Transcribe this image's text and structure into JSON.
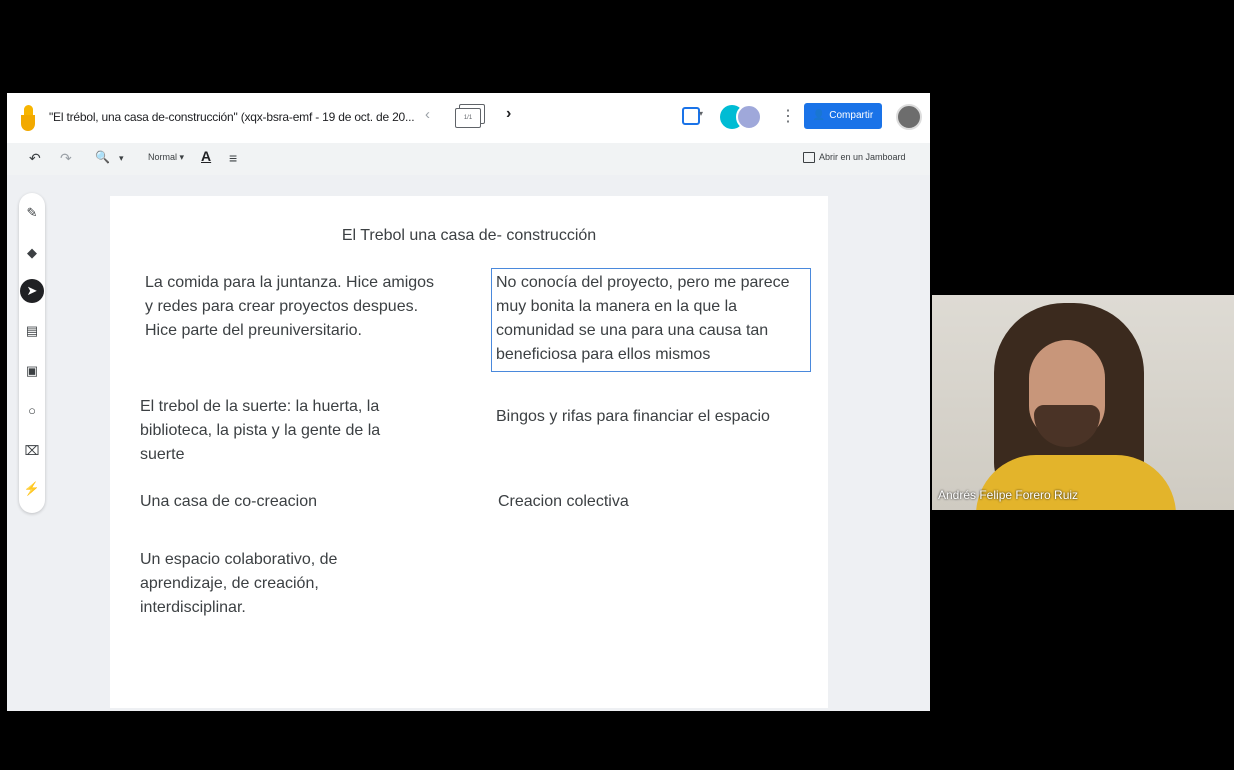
{
  "header": {
    "doc_title": "\"El trébol, una casa de-construcción\" (xqx-bsra-emf - 19 de oct. de 20...",
    "prev_icon": "chevron-left-icon",
    "frame_counter": "1/1",
    "next_icon": "chevron-right-icon",
    "share_label": "Compartir",
    "share_color": "#1a73e8"
  },
  "toolbar": {
    "undo_glyph": "↶",
    "redo_glyph": "↷",
    "zoom_glyph": "🔍",
    "zoom_arrow": "▾",
    "text_style": "Normal ▾",
    "text_color_glyph": "A",
    "align_glyph": "≡",
    "open_jamboard": "Abrir en un Jamboard"
  },
  "tools": [
    "pen-icon",
    "eraser-icon",
    "select-icon",
    "sticky-note-icon",
    "image-icon",
    "circle-icon",
    "text-box-icon",
    "laser-icon"
  ],
  "board": {
    "title": "El Trebol una casa de- construcción",
    "notes": [
      "La comida para la juntanza. Hice amigos y redes para crear proyectos despues. Hice parte del preuniversitario.",
      "No conocía del proyecto, pero me parece muy bonita la manera en la que la comunidad se una para una causa tan beneficiosa para ellos mismos",
      "El trebol de la suerte: la huerta, la biblioteca, la pista y la gente de la suerte",
      "Bingos y rifas para financiar el espacio",
      "Una casa de co-creacion",
      "Creacion colectiva",
      "Un espacio colaborativo, de aprendizaje, de creación, interdisciplinar."
    ]
  },
  "participant": {
    "name": "Andrés Felipe Forero Ruiz"
  }
}
